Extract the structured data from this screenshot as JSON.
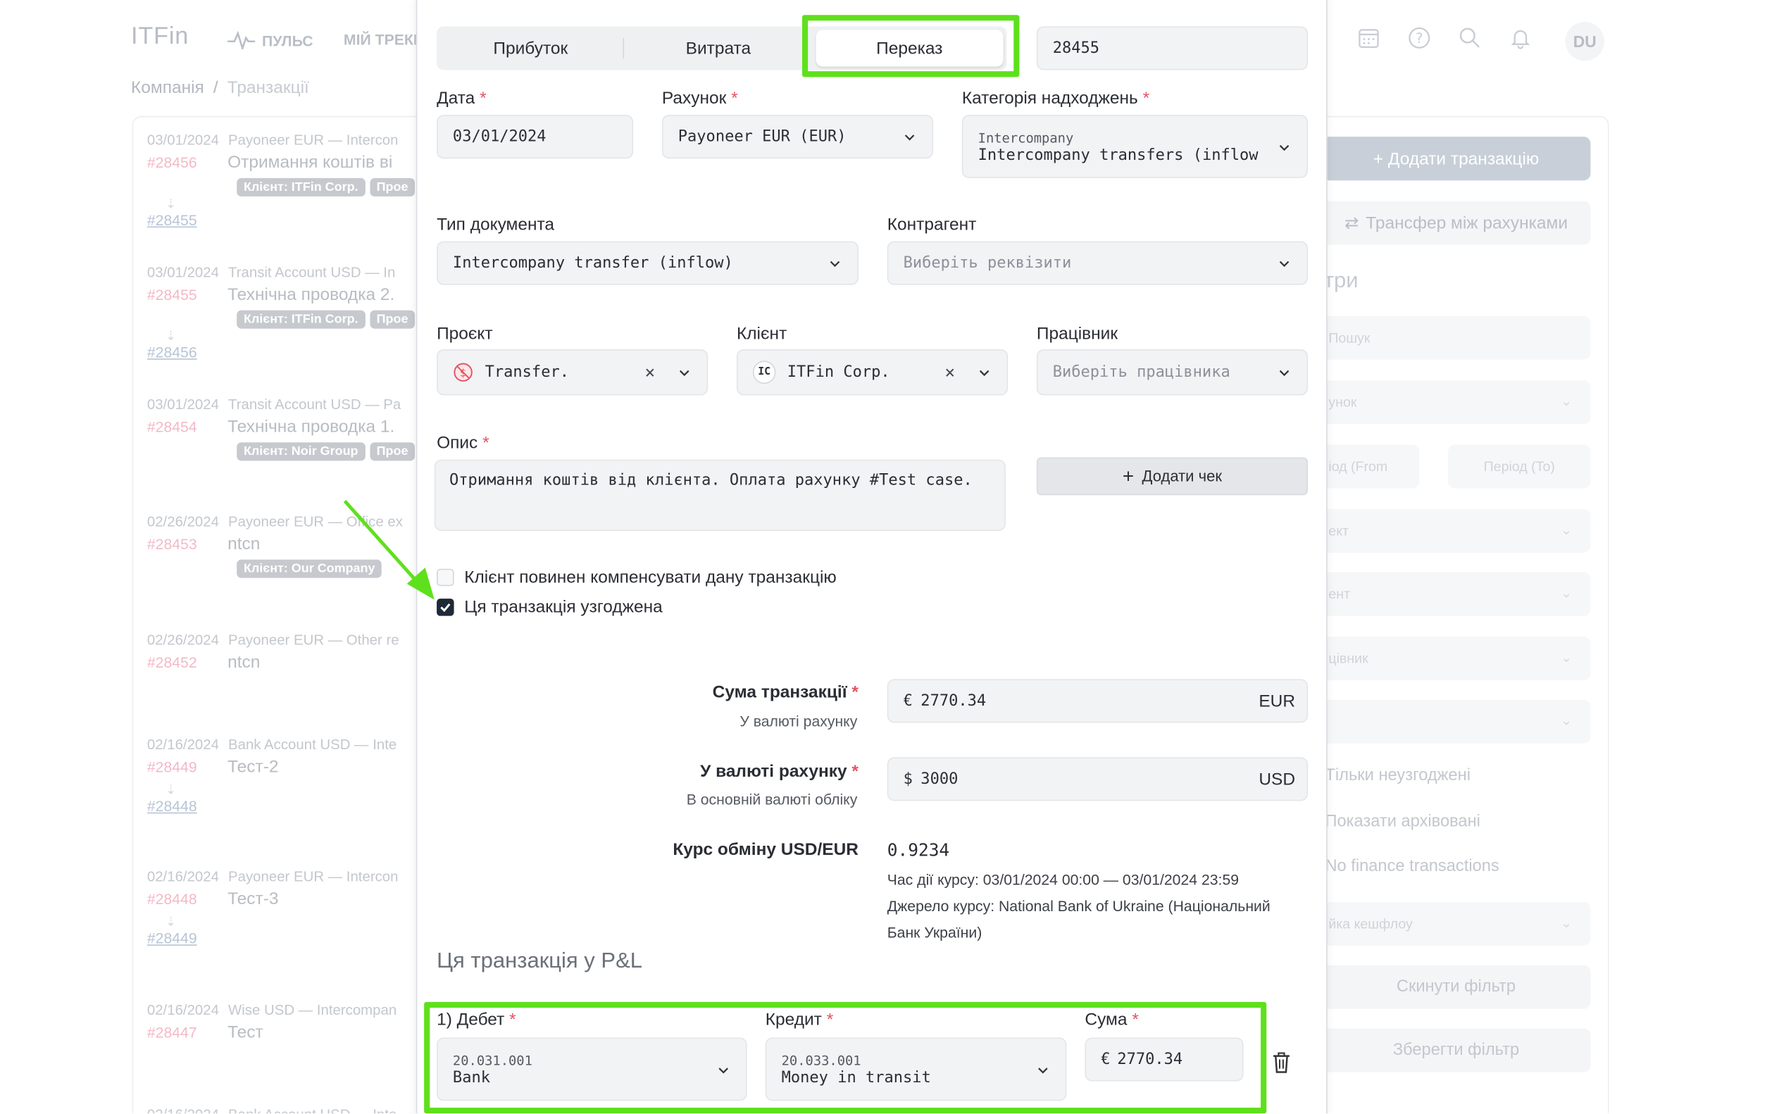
{
  "app": {
    "logo": "ITFin",
    "nav": [
      {
        "label": "ПУЛЬС"
      },
      {
        "label": "МІЙ ТРЕКЕ"
      }
    ],
    "breadcrumb": {
      "root": "Компанія",
      "sep": "/",
      "current": "Транзакції"
    },
    "icons": [
      "calendar-icon",
      "help-icon",
      "search-icon",
      "bell-icon"
    ],
    "avatar": "DU"
  },
  "list": [
    {
      "date": "03/01/2024",
      "account": "Payoneer EUR — Intercon",
      "id": "#28456",
      "title": "Отримання коштів ві",
      "tags": [
        "Клієнт: ITFin Corp.",
        "Прое"
      ],
      "linked": "#28455"
    },
    {
      "date": "03/01/2024",
      "account": "Transit Account USD — In",
      "id": "#28455",
      "title": "Технічна проводка 2.",
      "tags": [
        "Клієнт: ITFin Corp.",
        "Прое"
      ],
      "linked": "#28456"
    },
    {
      "date": "03/01/2024",
      "account": "Transit Account USD — Pa",
      "id": "#28454",
      "title": "Технічна проводка 1.",
      "tags": [
        "Клієнт: Noir Group",
        "Прое"
      ],
      "linked": ""
    },
    {
      "date": "02/26/2024",
      "account": "Payoneer EUR — Office ex",
      "id": "#28453",
      "title": "ntcn",
      "tags": [
        "Клієнт: Our Company"
      ],
      "linked": ""
    },
    {
      "date": "02/26/2024",
      "account": "Payoneer EUR — Other re",
      "id": "#28452",
      "title": "ntcn",
      "tags": [],
      "linked": ""
    },
    {
      "date": "02/16/2024",
      "account": "Bank Account USD — Inte",
      "id": "#28449",
      "title": "Тест-2",
      "tags": [],
      "linked": "#28448"
    },
    {
      "date": "02/16/2024",
      "account": "Payoneer EUR — Intercon",
      "id": "#28448",
      "title": "Тест-3",
      "tags": [],
      "linked": "#28449"
    },
    {
      "date": "02/16/2024",
      "account": "Wise USD — Intercompan",
      "id": "#28447",
      "title": "Тест",
      "tags": [],
      "linked": ""
    },
    {
      "date": "02/16/2024",
      "account": "Bank Account USD — Inte",
      "id": "",
      "title": "",
      "tags": [],
      "linked": ""
    }
  ],
  "sidebar": {
    "add_button": "+ Додати транзакцію",
    "transfer_button": "Трансфер між рахунками",
    "filters_title": "три",
    "search_placeholder": "Пошук",
    "account": "унок",
    "period_from": "іод (From",
    "period_to": "Період (To)",
    "project": "ект",
    "client": "ент",
    "employee": "цівник",
    "empty": "",
    "only_unreconciled": "Тільки неузгоджені",
    "show_archived": "Показати архівовані",
    "no_finance": "No finance transactions",
    "cashflow": "йка кешфлоу",
    "reset": "Скинути фільтр",
    "save": "Зберегти фільтр"
  },
  "modal": {
    "tabs": [
      {
        "label": "Прибуток"
      },
      {
        "label": "Витрата"
      },
      {
        "label": "Переказ"
      }
    ],
    "active_tab": "Переказ",
    "linked_id": "28455",
    "date": {
      "label": "Дата",
      "value": "03/01/2024"
    },
    "account": {
      "label": "Рахунок",
      "value": "Payoneer EUR (EUR)"
    },
    "category": {
      "label": "Категорія надходжень",
      "group": "Intercompany",
      "value": "Intercompany transfers (inflow"
    },
    "doc_type": {
      "label": "Тип документа",
      "value": "Intercompany transfer (inflow)"
    },
    "counterparty": {
      "label": "Контрагент",
      "placeholder": "Виберіть реквізити"
    },
    "project": {
      "label": "Проєкт",
      "value": "Transfer."
    },
    "client": {
      "label": "Клієнт",
      "badge": "IC",
      "value": "ITFin Corp."
    },
    "employee": {
      "label": "Працівник",
      "placeholder": "Виберіть працівника"
    },
    "description": {
      "label": "Опис",
      "value": "Отримання коштів від клієнта. Оплата рахунку #Test case."
    },
    "receipt_button": "Додати чек",
    "compensate": {
      "label": "Клієнт повинен компенсувати дану транзакцію",
      "checked": false
    },
    "reconciled": {
      "label": "Ця транзакція узгоджена",
      "checked": true
    },
    "amount": {
      "label": "Сума транзакції",
      "sub": "У валюті рахунку",
      "symbol": "€",
      "value": "2770.34",
      "currency": "EUR"
    },
    "base_amount": {
      "label": "У валюті рахунку",
      "sub": "В основній валюті обліку",
      "symbol": "$",
      "value": "3000",
      "currency": "USD"
    },
    "rate": {
      "label": "Курс обміну USD/EUR",
      "value": "0.9234",
      "period": "Час дії курсу: 03/01/2024 00:00 — 03/01/2024 23:59",
      "source_line1": "Джерело курсу: National Bank of Ukraine (Національний",
      "source_line2": "Банк України)"
    },
    "pl": {
      "title": "Ця транзакція у P&L",
      "debit_label": "1) Дебет",
      "credit_label": "Кредит",
      "sum_label": "Сума",
      "debit": {
        "code": "20.031.001",
        "name": "Bank"
      },
      "credit": {
        "code": "20.033.001",
        "name": "Money in transit"
      },
      "sum": {
        "symbol": "€",
        "value": "2770.34"
      }
    },
    "required_mark": "*"
  },
  "colors": {
    "highlight": "#5fe01c",
    "required": "#e25563",
    "checkbox": "#1f2937",
    "arrow": "#5fe01c"
  }
}
